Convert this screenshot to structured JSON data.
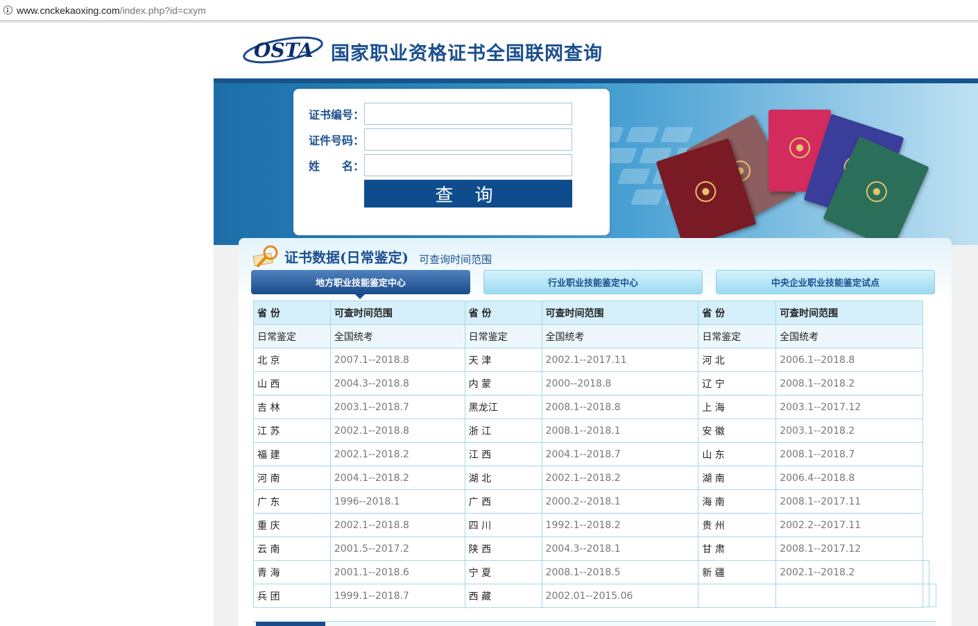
{
  "browser": {
    "url_host": "www.cnckekaoxing.com",
    "url_path": "/index.php?id=cxym"
  },
  "header": {
    "logo_text": "OSTA",
    "title": "国家职业资格证书全国联网查询"
  },
  "form": {
    "cert_no_label": "证书编号：",
    "id_no_label": "证件号码：",
    "name_label": "姓　　名：",
    "query_button": "查 询"
  },
  "section": {
    "title": "证书数据(日常鉴定)",
    "subtitle": "可查询时间范围"
  },
  "tabs": [
    {
      "label": "地方职业技能鉴定中心",
      "active": true
    },
    {
      "label": "行业职业技能鉴定中心",
      "active": false
    },
    {
      "label": "中央企业职业技能鉴定试点",
      "active": false
    }
  ],
  "table": {
    "headers": [
      "省 份",
      "可查时间范围",
      "省 份",
      "可查时间范围",
      "省 份",
      "可查时间范围"
    ],
    "subheaders": [
      "日常鉴定",
      "全国统考",
      "日常鉴定",
      "全国统考",
      "日常鉴定",
      "全国统考"
    ],
    "rows": [
      [
        "北 京",
        "2007.1--2018.8",
        "天 津",
        "2002.1--2017.11",
        "河 北",
        "2006.1--2018.8"
      ],
      [
        "山 西",
        "2004.3--2018.8",
        "内 蒙",
        "2000--2018.8",
        "辽 宁",
        "2008.1--2018.2"
      ],
      [
        "吉 林",
        "2003.1--2018.7",
        "黑龙江",
        "2008.1--2018.8",
        "上 海",
        "2003.1--2017.12"
      ],
      [
        "江 苏",
        "2002.1--2018.8",
        "浙 江",
        "2008.1--2018.1",
        "安 徽",
        "2003.1--2018.2"
      ],
      [
        "福 建",
        "2002.1--2018.2",
        "江 西",
        "2004.1--2018.7",
        "山 东",
        "2008.1--2018.7"
      ],
      [
        "河 南",
        "2004.1--2018.2",
        "湖 北",
        "2002.1--2018.2",
        "湖 南",
        "2006.4--2018.8"
      ],
      [
        "广 东",
        "1996--2018.1",
        "广 西",
        "2000.2--2018.1",
        "海 南",
        "2008.1--2017.11"
      ],
      [
        "重 庆",
        "2002.1--2018.8",
        "四 川",
        "1992.1--2018.2",
        "贵 州",
        "2002.2--2017.11"
      ],
      [
        "云 南",
        "2001.5--2017.2",
        "陕 西",
        "2004.3--2018.1",
        "甘 肃",
        "2008.1--2017.12"
      ],
      [
        "青 海",
        "2001.1--2018.6",
        "宁 夏",
        "2008.1--2018.5",
        "新 疆",
        "2002.1--2018.2"
      ],
      [
        "兵 团",
        "1999.1--2018.7",
        "西 藏",
        "2002.01--2015.06",
        "",
        ""
      ]
    ]
  },
  "colors": {
    "brand_blue": "#1c4f8f",
    "button_blue": "#0e4c8e",
    "table_border": "#a6d7e9",
    "header_bg": "#d5f0fa"
  }
}
